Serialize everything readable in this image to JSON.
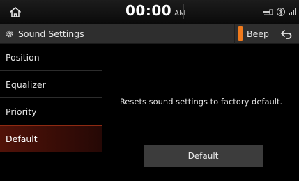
{
  "status_bar": {
    "time": "00:00",
    "ampm": "AM",
    "icons": [
      "home-icon",
      "usb-icon",
      "bluetooth-icon",
      "signal-icon"
    ]
  },
  "title_bar": {
    "title": "Sound Settings",
    "title_icon": "gear-icon",
    "beep_label": "Beep",
    "back_icon": "back-arrow-icon"
  },
  "menu": {
    "items": [
      {
        "label": "Position",
        "active": false
      },
      {
        "label": "Equalizer",
        "active": false
      },
      {
        "label": "Priority",
        "active": false
      },
      {
        "label": "Default",
        "active": true
      }
    ]
  },
  "content": {
    "description": "Resets sound settings to factory default.",
    "button_label": "Default"
  },
  "colors": {
    "accent": "#f07a1c",
    "active_item": "#511208",
    "background": "#000000"
  }
}
